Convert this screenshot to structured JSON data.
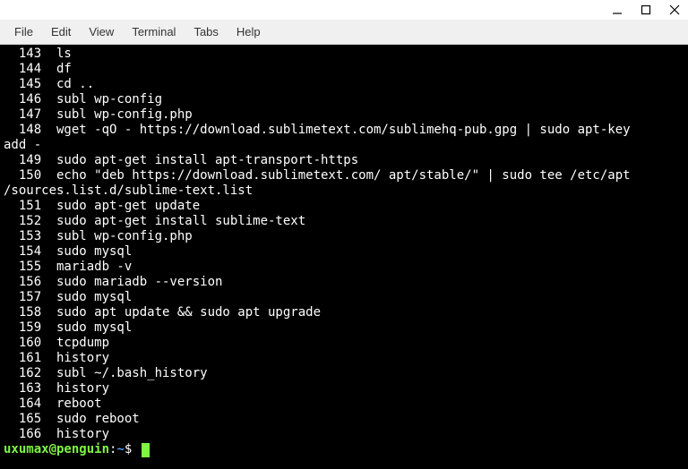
{
  "menubar": {
    "items": [
      "File",
      "Edit",
      "View",
      "Terminal",
      "Tabs",
      "Help"
    ]
  },
  "history": [
    {
      "num": "143",
      "cmd": "ls"
    },
    {
      "num": "144",
      "cmd": "df"
    },
    {
      "num": "145",
      "cmd": "cd .."
    },
    {
      "num": "146",
      "cmd": "subl wp-config"
    },
    {
      "num": "147",
      "cmd": "subl wp-config.php"
    },
    {
      "num": "148",
      "cmd": "wget -qO - https://download.sublimetext.com/sublimehq-pub.gpg | sudo apt-key ",
      "cont": "add -"
    },
    {
      "num": "149",
      "cmd": "sudo apt-get install apt-transport-https"
    },
    {
      "num": "150",
      "cmd": "echo \"deb https://download.sublimetext.com/ apt/stable/\" | sudo tee /etc/apt",
      "cont": "/sources.list.d/sublime-text.list"
    },
    {
      "num": "151",
      "cmd": "sudo apt-get update"
    },
    {
      "num": "152",
      "cmd": "sudo apt-get install sublime-text"
    },
    {
      "num": "153",
      "cmd": "subl wp-config.php"
    },
    {
      "num": "154",
      "cmd": "sudo mysql"
    },
    {
      "num": "155",
      "cmd": "mariadb -v"
    },
    {
      "num": "156",
      "cmd": "sudo mariadb --version"
    },
    {
      "num": "157",
      "cmd": "sudo mysql"
    },
    {
      "num": "158",
      "cmd": "sudo apt update && sudo apt upgrade"
    },
    {
      "num": "159",
      "cmd": "sudo mysql"
    },
    {
      "num": "160",
      "cmd": "tcpdump"
    },
    {
      "num": "161",
      "cmd": "history"
    },
    {
      "num": "162",
      "cmd": "subl ~/.bash_history"
    },
    {
      "num": "163",
      "cmd": "history"
    },
    {
      "num": "164",
      "cmd": "reboot"
    },
    {
      "num": "165",
      "cmd": "sudo reboot"
    },
    {
      "num": "166",
      "cmd": "history"
    }
  ],
  "prompt": {
    "user_host": "uxumax@penguin",
    "colon": ":",
    "path": "~",
    "dollar": "$"
  }
}
